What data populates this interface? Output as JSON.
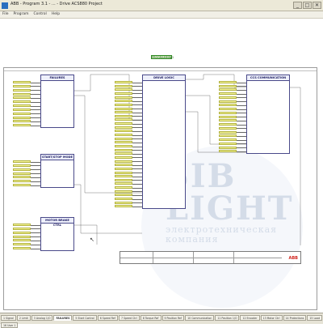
{
  "window": {
    "title": "ABB - Program 3.1 - ... - Drive ACS880 Project",
    "buttons": [
      "_",
      "□",
      "✕"
    ]
  },
  "menu": [
    "File",
    "Program",
    "Control",
    "Help"
  ],
  "status": {
    "label": "PROGRAMMING",
    "color": "#2f8a24"
  },
  "blocks": [
    {
      "id": "failures",
      "title": "FAILURES",
      "inputs": [
        "",
        "",
        "",
        "",
        "",
        "",
        "",
        "",
        "",
        "",
        "",
        ""
      ],
      "outputs": [
        "",
        "",
        "",
        "",
        ""
      ]
    },
    {
      "id": "drive-logic",
      "title": "DRIVE LOGIC",
      "inputs": [
        "",
        "",
        "",
        "",
        "",
        "",
        "",
        "",
        "",
        "",
        "",
        "",
        "",
        "",
        "",
        "",
        "",
        "",
        "",
        "",
        "",
        "",
        "",
        "",
        "",
        "",
        "",
        "",
        "",
        "",
        "",
        "",
        "",
        ""
      ],
      "outputs": [
        "",
        "",
        "",
        "",
        "",
        "",
        "",
        "",
        "",
        ""
      ]
    },
    {
      "id": "communication",
      "title": "CCS COMMUNICATION",
      "inputs": [
        "",
        "",
        "",
        "",
        "",
        "",
        "",
        "",
        "",
        "",
        "",
        "",
        "",
        "",
        "",
        "",
        "",
        "",
        ""
      ],
      "outputs": [
        "",
        "",
        "",
        "",
        "",
        ""
      ]
    },
    {
      "id": "start-stop",
      "title": "START/STOP MODE",
      "inputs": [
        "",
        "",
        "",
        "",
        "",
        "",
        ""
      ],
      "outputs": [
        ""
      ]
    },
    {
      "id": "motor-brake",
      "title": "MOTOR BRAKE CTRL",
      "inputs": [
        "",
        "",
        "",
        "",
        "",
        "",
        ""
      ],
      "outputs": [
        "",
        ""
      ]
    }
  ],
  "watermark": {
    "line1": "SIB",
    "line2": "LIGHT",
    "line3": "электротехническая",
    "line4": "компания"
  },
  "title_block": {
    "logo": "ABB"
  },
  "tabs": [
    {
      "label": "1 Signal",
      "active": false
    },
    {
      "label": "2 Limit",
      "active": false
    },
    {
      "label": "3 Analog 1/O",
      "active": false
    },
    {
      "label": "FAILURES",
      "active": true
    },
    {
      "label": "5 Start Control",
      "active": false
    },
    {
      "label": "6 Speed Ref",
      "active": false
    },
    {
      "label": "7 Speed Ctrl",
      "active": false
    },
    {
      "label": "8 Torque Ref",
      "active": false
    },
    {
      "label": "9 Position Ref",
      "active": false
    },
    {
      "label": "10 Communication",
      "active": false
    },
    {
      "label": "11 Position 1/O",
      "active": false
    },
    {
      "label": "12 Encoder",
      "active": false
    },
    {
      "label": "13 Motor Ctrl",
      "active": false
    },
    {
      "label": "14 Protections",
      "active": false
    },
    {
      "label": "15 Load",
      "active": false
    },
    {
      "label": "16 User 1",
      "active": false
    }
  ]
}
